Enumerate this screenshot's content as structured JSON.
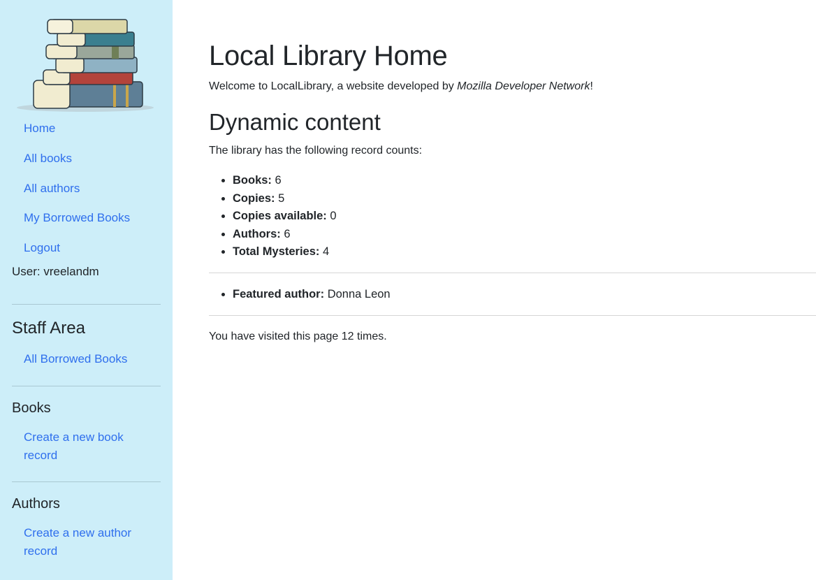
{
  "sidebar": {
    "logo_icon": "book-stack-image",
    "nav": [
      {
        "label": "Home"
      },
      {
        "label": "All books"
      },
      {
        "label": "All authors"
      },
      {
        "label": "My Borrowed Books"
      },
      {
        "label": "Logout"
      }
    ],
    "user_text": "User: vreelandm",
    "staff_heading": "Staff Area",
    "staff_link": "All Borrowed Books",
    "books_heading": "Books",
    "books_link": "Create a new book record",
    "authors_heading": "Authors",
    "authors_link": "Create a new author record",
    "colors": {
      "background": "#cdeef9",
      "link": "#2f6fed"
    }
  },
  "main": {
    "title": "Local Library Home",
    "welcome_prefix": "Welcome to LocalLibrary, a website developed by ",
    "welcome_emphasis": "Mozilla Developer Network",
    "welcome_suffix": "!",
    "section_title": "Dynamic content",
    "intro": "The library has the following record counts:",
    "counts": [
      {
        "label": "Books:",
        "value": "6"
      },
      {
        "label": "Copies:",
        "value": "5"
      },
      {
        "label": "Copies available:",
        "value": "0"
      },
      {
        "label": "Authors:",
        "value": "6"
      },
      {
        "label": "Total Mysteries:",
        "value": "4"
      }
    ],
    "featured": {
      "label": "Featured author:",
      "value": "Donna Leon"
    },
    "visits": "You have visited this page 12 times."
  }
}
